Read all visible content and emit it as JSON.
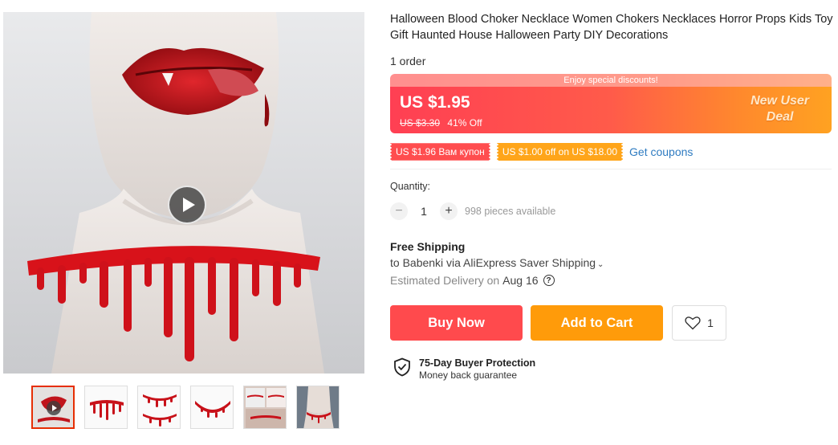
{
  "product": {
    "title": "Halloween Blood Choker Necklace Women Chokers Necklaces Horror Props Kids Toy Gift Haunted House Halloween Party DIY Decorations",
    "orders": "1 order"
  },
  "gallery": {
    "main_image_icon": "vampire-blood-choker-photo",
    "play_icon": "play-icon",
    "thumbnails": [
      {
        "icon": "vampire-lips-thumbnail"
      },
      {
        "icon": "blood-choker-thumbnail"
      },
      {
        "icon": "blood-choker-pair-thumbnail"
      },
      {
        "icon": "blood-choker-arc-thumbnail"
      },
      {
        "icon": "blood-choker-collage-thumbnail"
      },
      {
        "icon": "neck-choker-thumbnail"
      }
    ]
  },
  "pricing": {
    "banner_text": "Enjoy special discounts!",
    "price": "US $1.95",
    "original_price": "US $3.30",
    "discount": "41% Off",
    "new_user_line1": "New User",
    "new_user_line2": "Deal",
    "colors": {
      "banner_start": "#ff3f53",
      "banner_end": "#ffa221"
    }
  },
  "coupons": {
    "coupon1": "US $1.96 Вам купон",
    "coupon2": "US $1.00 off on US $18.00",
    "get_coupons": "Get coupons"
  },
  "quantity": {
    "label": "Quantity:",
    "minus": "−",
    "value": "1",
    "plus": "+",
    "available": "998 pieces available"
  },
  "shipping": {
    "title": "Free Shipping",
    "to": "to Babenki via AliExpress Saver Shipping",
    "estimated_label": "Estimated Delivery on",
    "date": "Aug 16",
    "help_icon": "question-circle-icon"
  },
  "actions": {
    "buy_now": "Buy Now",
    "add_to_cart": "Add to Cart",
    "wishlist_count": "1",
    "colors": {
      "buy": "#ff4a4d",
      "cart": "#ff9b0a"
    }
  },
  "protection": {
    "title": "75-Day Buyer Protection",
    "subtitle": "Money back guarantee",
    "icon": "shield-check-icon"
  }
}
